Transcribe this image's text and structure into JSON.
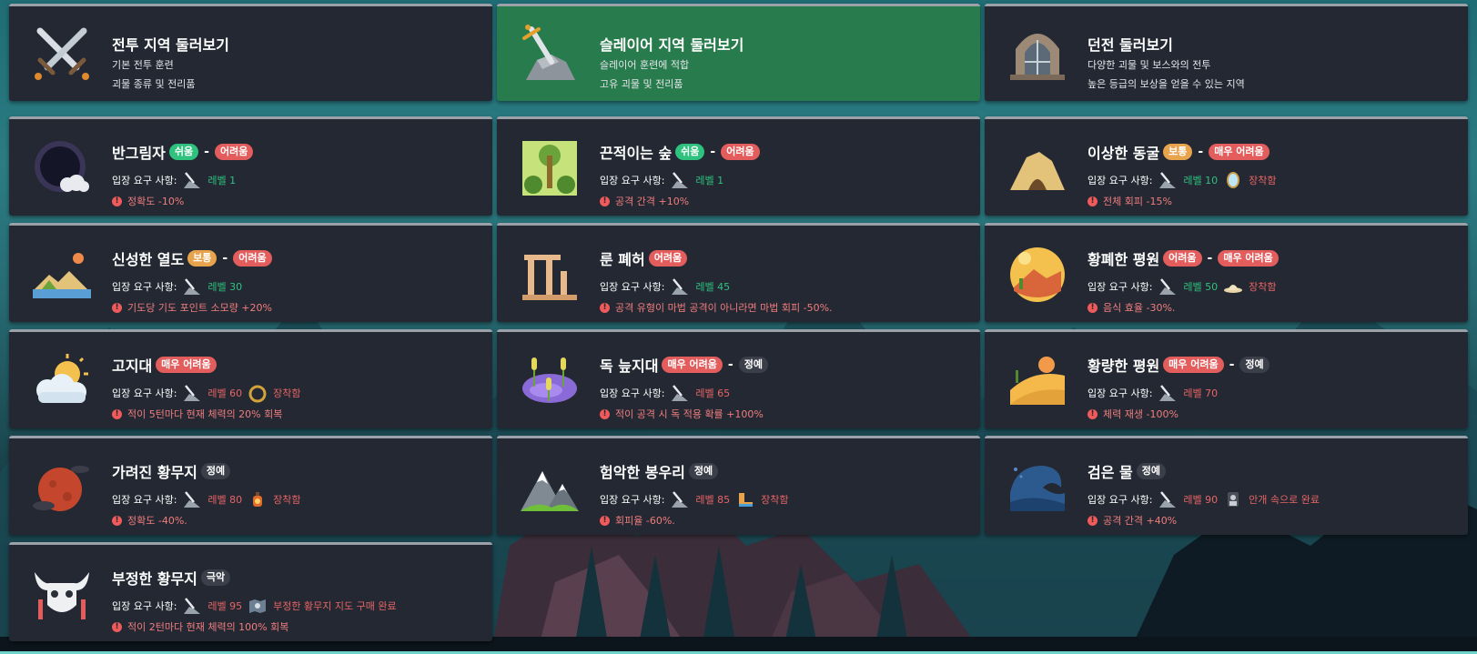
{
  "top_cards": [
    {
      "title": "전투 지역 둘러보기",
      "line1": "기본 전투 훈련",
      "line2": "괴물 종류 및 전리품"
    },
    {
      "title": "슬레이어 지역 둘러보기",
      "line1": "슬레이어 훈련에 적합",
      "line2": "고유 괴물 및 전리품"
    },
    {
      "title": "던전 둘러보기",
      "line1": "다양한 괴물 및 보스와의 전투",
      "line2": "높은 등급의 보상을 얻을 수 있는 지역"
    }
  ],
  "req_label": "입장 요구 사항:",
  "dash": "-",
  "zones": [
    {
      "name": "반그림자",
      "badge1": "쉬움",
      "badge2": "어려움",
      "level": "레벨 1",
      "equip": "",
      "effect": "정확도 -10%"
    },
    {
      "name": "끈적이는 숲",
      "badge1": "쉬움",
      "badge2": "어려움",
      "level": "레벨 1",
      "equip": "",
      "effect": "공격 간격 +10%"
    },
    {
      "name": "이상한 동굴",
      "badge1": "보통",
      "badge2": "매우 어려움",
      "level": "레벨 10",
      "equip": "장착함",
      "effect": "전체 회피 -15%"
    },
    {
      "name": "신성한 열도",
      "badge1": "보통",
      "badge2": "어려움",
      "level": "레벨 30",
      "equip": "",
      "effect": "기도당 기도 포인트 소모량 +20%"
    },
    {
      "name": "룬 폐허",
      "badge1": "어려움",
      "badge2": "",
      "level": "레벨 45",
      "equip": "",
      "effect": "공격 유형이 마법 공격이 아니라면 마법 회피 -50%."
    },
    {
      "name": "황폐한 평원",
      "badge1": "어려움",
      "badge2": "매우 어려움",
      "level": "레벨 50",
      "equip": "장착함",
      "effect": "음식 효율 -30%."
    },
    {
      "name": "고지대",
      "badge1": "매우 어려움",
      "badge2": "",
      "level": "레벨 60",
      "equip": "장착함",
      "effect": "적이 5턴마다 현재 체력의 20% 회복"
    },
    {
      "name": "독 늪지대",
      "badge1": "매우 어려움",
      "badge2": "정예",
      "level": "레벨 65",
      "equip": "",
      "effect": "적이 공격 시 독 적용 확률 +100%"
    },
    {
      "name": "황량한 평원",
      "badge1": "매우 어려움",
      "badge2": "정예",
      "level": "레벨 70",
      "equip": "",
      "effect": "체력 재생 -100%"
    },
    {
      "name": "가려진 황무지",
      "badge1": "정예",
      "badge2": "",
      "level": "레벨 80",
      "equip": "장착함",
      "effect": "정확도 -40%."
    },
    {
      "name": "험악한 봉우리",
      "badge1": "정예",
      "badge2": "",
      "level": "레벨 85",
      "equip": "장착함",
      "effect": "회피율 -60%."
    },
    {
      "name": "검은 물",
      "badge1": "정예",
      "badge2": "",
      "level": "레벨 90",
      "equip": "안개 속으로 완료",
      "effect": "공격 간격 +40%"
    },
    {
      "name": "부정한 황무지",
      "badge1": "극악",
      "badge2": "",
      "level": "레벨 95",
      "equip": "부정한 황무지 지도 구매 완료",
      "effect": "적이 2턴마다 현재 체력의 100% 회복"
    }
  ]
}
